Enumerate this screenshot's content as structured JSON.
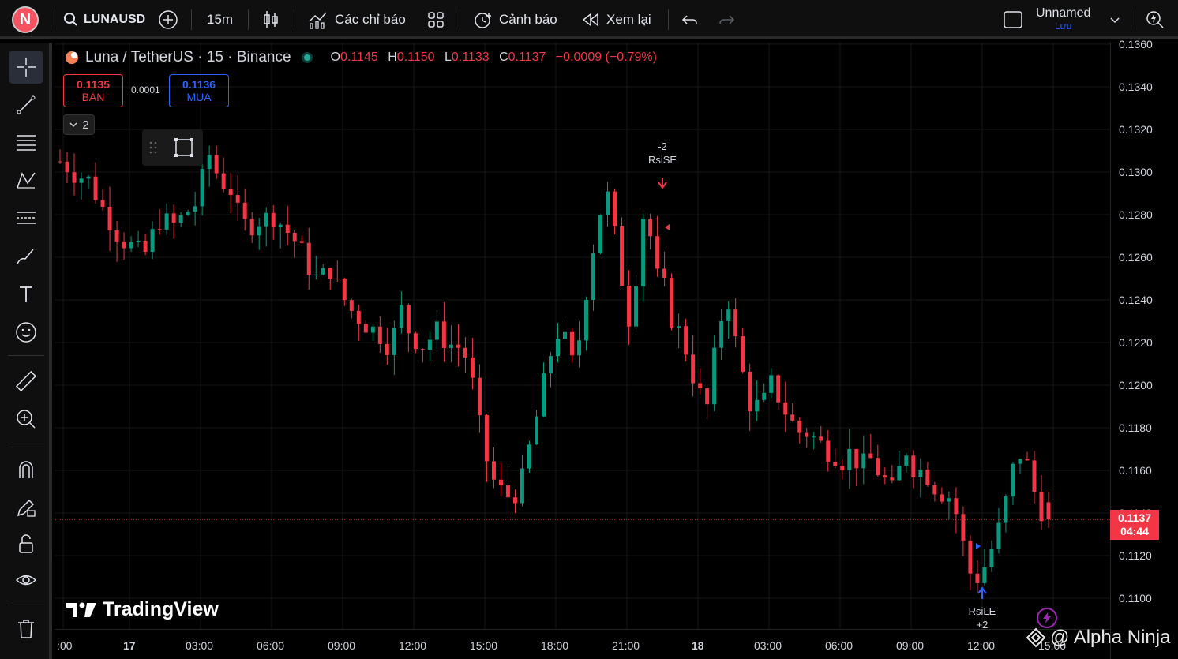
{
  "topbar": {
    "avatar_letter": "N",
    "symbol": "LUNAUSD",
    "interval": "15m",
    "indicators_label": "Các chỉ báo",
    "alert_label": "Cảnh báo",
    "replay_label": "Xem lại",
    "layout_name": "Unnamed",
    "layout_status": "Lưu"
  },
  "legend": {
    "title": "Luna / TetherUS · 15 · Binance",
    "o_label": "O",
    "o": "0.1145",
    "h_label": "H",
    "h": "0.1150",
    "l_label": "L",
    "l": "0.1133",
    "c_label": "C",
    "c": "0.1137",
    "change": "−0.0009 (−0.79%)"
  },
  "trade": {
    "sell_price": "0.1135",
    "sell_label": "BÁN",
    "spread": "0.0001",
    "buy_price": "0.1136",
    "buy_label": "MUA"
  },
  "collapse_count": "2",
  "signals": {
    "short_qty": "-2",
    "short_name": "RsiSE",
    "long_name": "RsiLE",
    "long_qty": "+2"
  },
  "price_axis": [
    "0.1360",
    "0.1340",
    "0.1320",
    "0.1300",
    "0.1280",
    "0.1260",
    "0.1240",
    "0.1220",
    "0.1200",
    "0.1180",
    "0.1160",
    "0.1140",
    "0.1120",
    "0.1100"
  ],
  "current_price": {
    "price": "0.1137",
    "countdown": "04:44"
  },
  "time_axis": [
    ":00",
    "17",
    "03:00",
    "06:00",
    "09:00",
    "12:00",
    "15:00",
    "18:00",
    "21:00",
    "18",
    "03:00",
    "06:00",
    "09:00",
    "12:00",
    "15:00"
  ],
  "logo_text": "TradingView",
  "watermark": "@ Alpha Ninja",
  "colors": {
    "up": "#089981",
    "down": "#f23645",
    "accent": "#2962ff",
    "background": "#000000"
  },
  "chart_data": {
    "type": "candlestick",
    "title": "Luna / TetherUS · 15 · Binance",
    "xlabel": "",
    "ylabel": "",
    "ylim": [
      0.1095,
      0.1365
    ],
    "x_ticks": [
      ":00",
      "17",
      "03:00",
      "06:00",
      "09:00",
      "12:00",
      "15:00",
      "18:00",
      "21:00",
      "18",
      "03:00",
      "06:00",
      "09:00",
      "12:00",
      "15:00"
    ],
    "close_path": [
      0.1305,
      0.1303,
      0.13,
      0.1298,
      0.1296,
      0.129,
      0.1283,
      0.1278,
      0.1272,
      0.1268,
      0.1265,
      0.1262,
      0.1262,
      0.127,
      0.1278,
      0.1276,
      0.1275,
      0.1278,
      0.1282,
      0.1285,
      0.1296,
      0.1308,
      0.13,
      0.1295,
      0.1292,
      0.128,
      0.1275,
      0.1276,
      0.1278,
      0.1278,
      0.128,
      0.1276,
      0.1272,
      0.1268,
      0.1262,
      0.1256,
      0.125,
      0.1251,
      0.1255,
      0.1246,
      0.124,
      0.1235,
      0.1232,
      0.1229,
      0.1226,
      0.1224,
      0.122,
      0.1224,
      0.1235,
      0.1226,
      0.1222,
      0.1219,
      0.1222,
      0.1225,
      0.1222,
      0.1219,
      0.1218,
      0.1214,
      0.12,
      0.118,
      0.1165,
      0.1155,
      0.115,
      0.1148,
      0.115,
      0.1155,
      0.117,
      0.1185,
      0.12,
      0.1215,
      0.1225,
      0.122,
      0.121,
      0.1222,
      0.1245,
      0.1265,
      0.1282,
      0.1288,
      0.127,
      0.125,
      0.1232,
      0.1252,
      0.128,
      0.127,
      0.125,
      0.1245,
      0.1232,
      0.1225,
      0.1217,
      0.1205,
      0.1195,
      0.119,
      0.1212,
      0.1232,
      0.124,
      0.122,
      0.1205,
      0.1192,
      0.119,
      0.1192,
      0.12,
      0.1195,
      0.1188,
      0.1182,
      0.1178,
      0.1178,
      0.1175,
      0.1172,
      0.117,
      0.1168,
      0.1165,
      0.1168,
      0.1165,
      0.1162,
      0.1165,
      0.116,
      0.1155,
      0.115,
      0.116,
      0.117,
      0.1162,
      0.116,
      0.1158,
      0.1153,
      0.115,
      0.1148,
      0.114,
      0.1125,
      0.1112,
      0.111,
      0.1115,
      0.1123,
      0.1132,
      0.1145,
      0.116,
      0.1168,
      0.1162,
      0.115,
      0.1142,
      0.1137
    ],
    "last": {
      "open": 0.1145,
      "high": 0.115,
      "low": 0.1133,
      "close": 0.1137
    }
  }
}
